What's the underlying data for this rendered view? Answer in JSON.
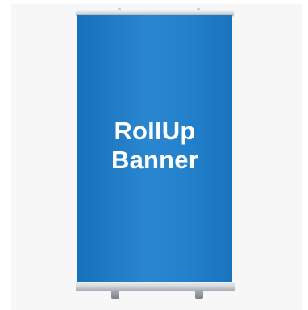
{
  "banner": {
    "line1": "RollUp",
    "line2": "Banner",
    "color": "#2381cc",
    "text_color": "#ffffff"
  },
  "stand": {
    "finish": "silver-aluminium"
  },
  "background_color": "#f7f7f7"
}
